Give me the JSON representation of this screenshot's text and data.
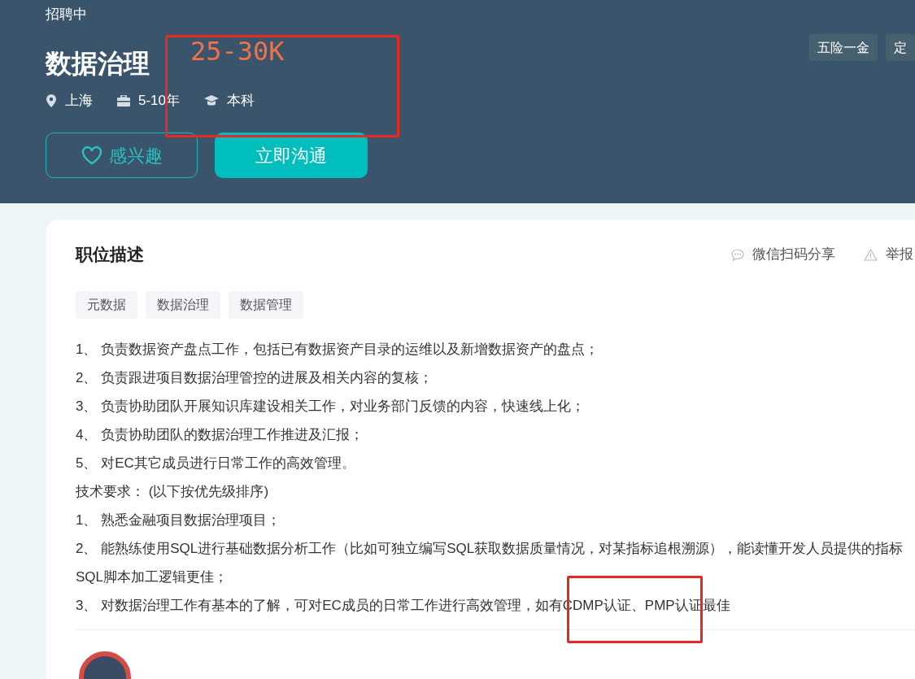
{
  "header": {
    "status": "招聘中",
    "title": "数据治理",
    "salary": "25-30K",
    "meta": [
      {
        "kind": "location",
        "text": "上海"
      },
      {
        "kind": "experience",
        "text": "5-10年"
      },
      {
        "kind": "education",
        "text": "本科"
      }
    ],
    "benefits": [
      "五险一金",
      "定"
    ],
    "buttons": [
      {
        "kind": "outline",
        "label": "感兴趣"
      },
      {
        "kind": "primary",
        "label": "立即沟通"
      }
    ]
  },
  "description": {
    "title": "职位描述",
    "actions": [
      {
        "kind": "share",
        "label": "微信扫码分享"
      },
      {
        "kind": "report",
        "label": "举报"
      }
    ],
    "tags": [
      "元数据",
      "数据治理",
      "数据管理"
    ],
    "lines": [
      "1、 负责数据资产盘点工作，包括已有数据资产目录的运维以及新增数据资产的盘点；",
      "2、 负责跟进项目数据治理管控的进展及相关内容的复核；",
      "3、 负责协助团队开展知识库建设相关工作，对业务部门反馈的内容，快速线上化；",
      "4、 负责协助团队的数据治理工作推进及汇报；",
      "5、 对EC其它成员进行日常工作的高效管理。",
      "技术要求： (以下按优先级排序)",
      "1、 熟悉金融项目数据治理项目；",
      "2、 能熟练使用SQL进行基础数据分析工作（比如可独立编写SQL获取数据质量情况，对某指标追根溯源），能读懂开发人员提供的指标SQL脚本加工逻辑更佳；",
      "3、 对数据治理工作有基本的了解，可对EC成员的日常工作进行高效管理，如有CDMP认证、PMP认证最佳"
    ]
  }
}
